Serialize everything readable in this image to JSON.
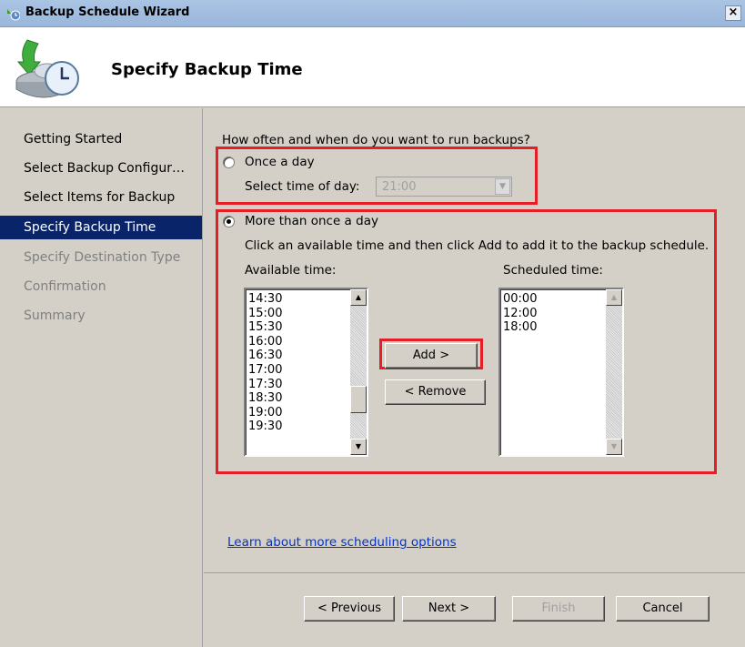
{
  "window": {
    "title": "Backup Schedule Wizard",
    "close_label": "×"
  },
  "header": {
    "title": "Specify Backup Time",
    "icon": "backup-clock-icon"
  },
  "nav": {
    "items": [
      {
        "label": "Getting Started",
        "state": "normal"
      },
      {
        "label": "Select Backup Configur…",
        "state": "normal"
      },
      {
        "label": "Select Items for Backup",
        "state": "normal"
      },
      {
        "label": "Specify Backup Time",
        "state": "active"
      },
      {
        "label": "Specify Destination Type",
        "state": "disabled"
      },
      {
        "label": "Confirmation",
        "state": "disabled"
      },
      {
        "label": "Summary",
        "state": "disabled"
      }
    ]
  },
  "main": {
    "question": "How often and when do you want to run backups?",
    "once_a_day": {
      "label": "Once a day",
      "selected": false,
      "time_label": "Select time of day:",
      "time_value": "21:00"
    },
    "more_than_once": {
      "label": "More than once a day",
      "selected": true,
      "instruction": "Click an available time and then click Add to add it to the backup schedule.",
      "available_label": "Available time:",
      "available_times": [
        "14:30",
        "15:00",
        "15:30",
        "16:00",
        "16:30",
        "17:00",
        "17:30",
        "18:30",
        "19:00",
        "19:30"
      ],
      "scheduled_label": "Scheduled time:",
      "scheduled_times": [
        "00:00",
        "12:00",
        "18:00"
      ],
      "add_label": "Add >",
      "remove_label": "< Remove"
    },
    "link": "Learn about more scheduling options"
  },
  "footer": {
    "previous_label": "< Previous",
    "next_label": "Next >",
    "finish_label": "Finish",
    "cancel_label": "Cancel"
  },
  "colors": {
    "highlight": "#e31e24",
    "nav_active": "#0a246a",
    "link": "#0033cc"
  }
}
